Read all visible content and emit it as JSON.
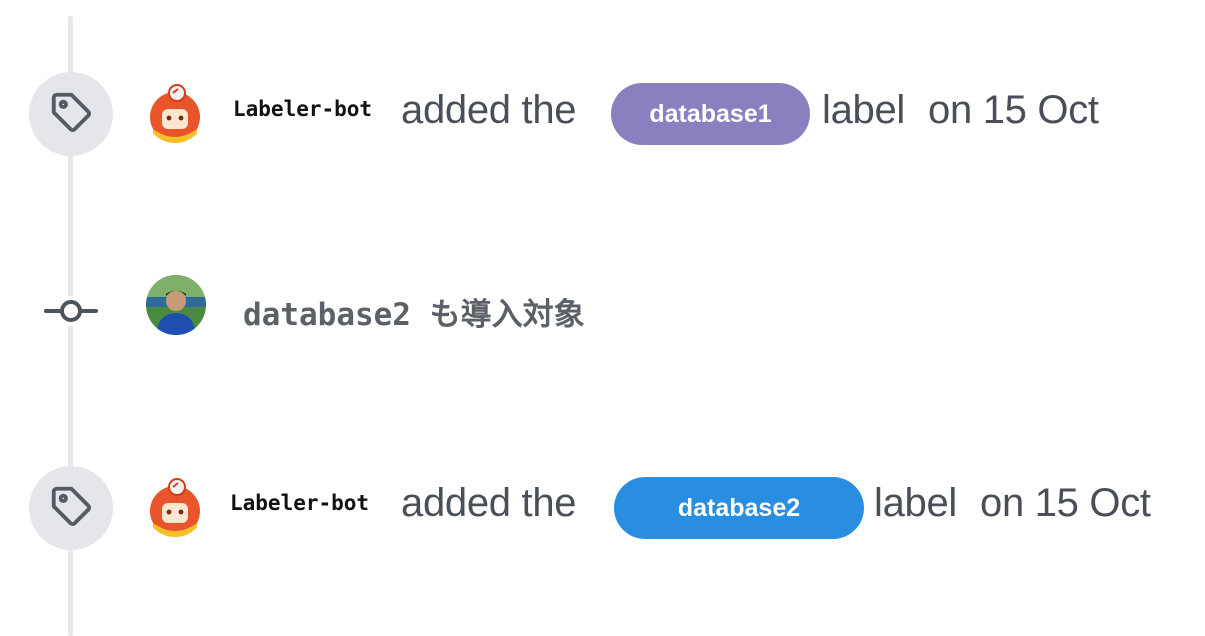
{
  "timeline": {
    "events": [
      {
        "type": "label",
        "actor": "Labeler-bot",
        "action": "added the",
        "label": "database1",
        "label_color": "#8c7fc0",
        "suffix": "label",
        "date": "on 15 Oct",
        "icon": "tag-icon"
      },
      {
        "type": "commit",
        "message": "database2 も導入対象",
        "icon": "git-commit-icon"
      },
      {
        "type": "label",
        "actor": "Labeler-bot",
        "action": "added the",
        "label": "database2",
        "label_color": "#2a8ee0",
        "suffix": "label",
        "date": "on 15 Oct",
        "icon": "tag-icon"
      }
    ]
  },
  "colors": {
    "timeline": "#e6e8ec",
    "badge_bg": "#e4e6ea",
    "text": "#4a4f57",
    "bot_orange": "#e8552a"
  }
}
